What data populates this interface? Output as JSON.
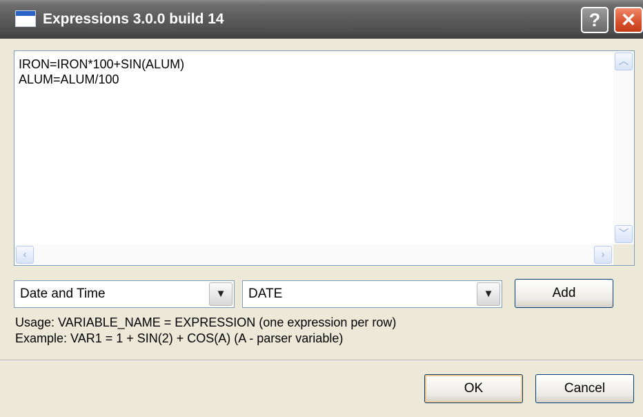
{
  "window": {
    "title": "Expressions 3.0.0 build 14"
  },
  "title_buttons": {
    "help": "?",
    "close": "✕"
  },
  "editor": {
    "lines": [
      "IRON=IRON*100+SIN(ALUM)",
      "ALUM=ALUM/100"
    ]
  },
  "scroll_glyphs": {
    "up": "︿",
    "down": "﹀",
    "left": "‹",
    "right": "›"
  },
  "category_select": {
    "value": "Date and Time"
  },
  "function_select": {
    "value": "DATE"
  },
  "add_button": {
    "label": "Add"
  },
  "usage": {
    "line1": "Usage: VARIABLE_NAME = EXPRESSION (one expression per row)",
    "line2": "Example: VAR1 = 1 + SIN(2) + COS(A) (A - parser variable)"
  },
  "dialog_buttons": {
    "ok": "OK",
    "cancel": "Cancel"
  },
  "dropdown_glyph": "▼",
  "colors": {
    "title_bar": "#5a5a5a",
    "close_button": "#d9542f",
    "dialog_bg": "#ece9d8"
  }
}
